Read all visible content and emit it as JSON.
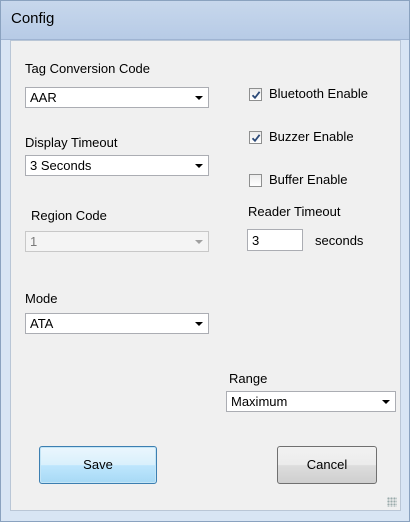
{
  "window": {
    "title": "Config"
  },
  "tag_conversion": {
    "label": "Tag Conversion Code",
    "value": "AAR"
  },
  "display_timeout": {
    "label": "Display Timeout",
    "value": "3 Seconds"
  },
  "region_code": {
    "label": "Region Code",
    "value": "1",
    "disabled": true
  },
  "mode": {
    "label": "Mode",
    "value": "ATA"
  },
  "checkboxes": [
    {
      "label": "Bluetooth Enable",
      "checked": true
    },
    {
      "label": "Buzzer Enable",
      "checked": true
    },
    {
      "label": "Buffer Enable",
      "checked": false
    }
  ],
  "reader_timeout": {
    "label": "Reader Timeout",
    "value": "3",
    "unit": "seconds"
  },
  "range": {
    "label": "Range",
    "value": "Maximum"
  },
  "buttons": {
    "save": "Save",
    "cancel": "Cancel"
  },
  "colors": {
    "check_mark": "#2c4a78",
    "focus_border": "#3c7fb1"
  },
  "icons": {
    "dropdown": "chevron-down-icon",
    "check": "check-icon",
    "resize": "resize-grip-icon"
  }
}
